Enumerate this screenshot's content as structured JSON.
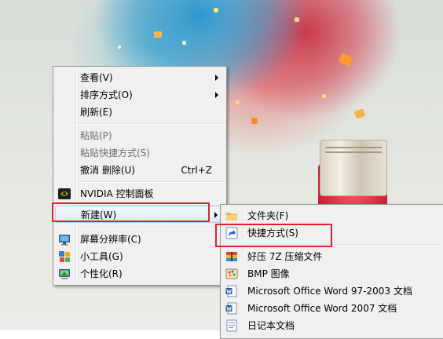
{
  "main_menu": {
    "view": "查看(V)",
    "sort_by": "排序方式(O)",
    "refresh": "刷新(E)",
    "paste": "粘贴(P)",
    "paste_shortcut": "粘贴快捷方式(S)",
    "undo_delete": "撤消 删除(U)",
    "undo_shortcut": "Ctrl+Z",
    "nvidia": "NVIDIA 控制面板",
    "new": "新建(W)",
    "screen_resolution": "屏幕分辨率(C)",
    "gadgets": "小工具(G)",
    "personalize": "个性化(R)"
  },
  "sub_menu": {
    "folder": "文件夹(F)",
    "shortcut": "快捷方式(S)",
    "archive_7z": "好压 7Z 压缩文件",
    "bmp": "BMP 图像",
    "word_97": "Microsoft Office Word 97-2003 文档",
    "word_2007": "Microsoft Office Word 2007 文档",
    "text_doc": "日记本文档"
  },
  "colors": {
    "highlight_border": "#aecff7",
    "annotation_red": "#e0202a",
    "menu_background": "#f0f0f0"
  },
  "icons": {
    "nvidia": "nvidia-icon",
    "screen_resolution": "monitor-icon",
    "gadgets": "gadgets-icon",
    "personalize": "personalize-icon",
    "folder": "folder-icon",
    "shortcut": "shortcut-icon",
    "archive": "archive-icon",
    "bmp": "paint-icon",
    "word_97": "word-icon",
    "word_2007": "word-icon",
    "text_doc": "text-document-icon"
  }
}
